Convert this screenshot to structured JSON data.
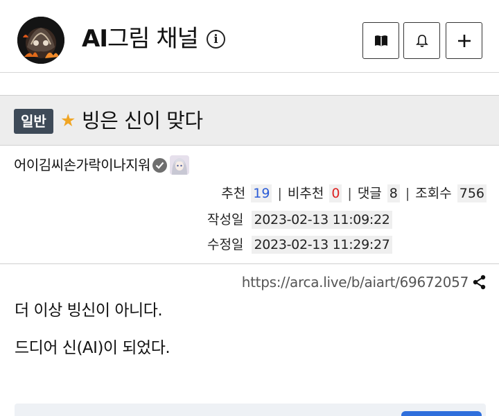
{
  "channel": {
    "title_prefix": "AI",
    "title_suffix": "그림 채널",
    "info_icon": "info-icon",
    "buttons": [
      {
        "name": "bookmark-button",
        "icon": "book-icon"
      },
      {
        "name": "notify-button",
        "icon": "bell-icon"
      },
      {
        "name": "subscribe-button",
        "icon": "plus-icon"
      }
    ]
  },
  "article": {
    "category": "일반",
    "star_icon": "star-icon",
    "title": "빙은 신이 맞다"
  },
  "meta": {
    "author": "어이김씨손가락이나지워",
    "stats": {
      "upvote_label": "추천",
      "upvote_value": "19",
      "downvote_label": "비추천",
      "downvote_value": "0",
      "comments_label": "댓글",
      "comments_value": "8",
      "views_label": "조회수",
      "views_value": "756"
    },
    "created_label": "작성일",
    "created_value": "2023-02-13 11:09:22",
    "edited_label": "수정일",
    "edited_value": "2023-02-13 11:29:27"
  },
  "body": {
    "url": "https://arca.live/b/aiart/69672057",
    "paragraphs": [
      "더 이상 빙신이 아니다.",
      "드디어 신(AI)이 되었다."
    ]
  },
  "colors": {
    "badge_bg": "#3e4a58",
    "star": "#f0a524",
    "upvote": "#2a5bd7",
    "downvote": "#dd2222",
    "title_bar_bg": "#ededed"
  }
}
